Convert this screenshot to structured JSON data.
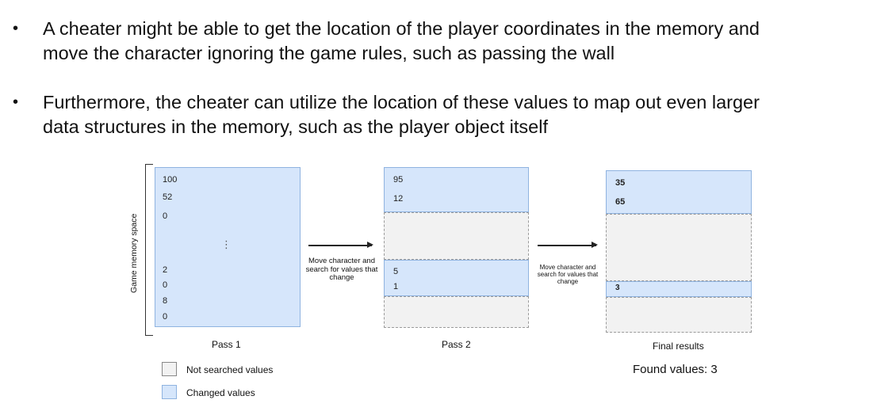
{
  "bullets": [
    {
      "symbol": "•",
      "text": "A cheater might be able to get the location of the player coordinates in the memory and\nmove the character ignoring the game rules, such as passing the wall"
    },
    {
      "symbol": "•",
      "text": "Furthermore, the cheater can utilize the location of these values to map out even larger\ndata structures in the memory, such as the player object itself"
    }
  ],
  "diagram": {
    "axis_label": "Game memory space",
    "pass1": {
      "label": "Pass 1",
      "top_values": [
        "100",
        "52",
        "0"
      ],
      "ellipsis": "⋮",
      "bottom_values": [
        "2",
        "0",
        "8",
        "0"
      ]
    },
    "step1_label": "Move character and\nsearch for values that\nchange",
    "pass2": {
      "label": "Pass 2",
      "group1": [
        "95",
        "12"
      ],
      "group2": [
        "5",
        "1"
      ]
    },
    "step2_label": "Move character  and\nsearch for values that\nchange",
    "final": {
      "label": "Final results",
      "group1": [
        "35",
        "65"
      ],
      "group2": [
        "3"
      ],
      "found_text": "Found values: 3"
    },
    "legend": [
      {
        "label": "Not searched values",
        "color": "#f2f2f2"
      },
      {
        "label": "Changed values",
        "color": "#d6e6fb"
      }
    ]
  },
  "colors": {
    "changed": "#d6e6fb",
    "changed_border": "#8fb3e0",
    "unsearched": "#f2f2f2"
  }
}
